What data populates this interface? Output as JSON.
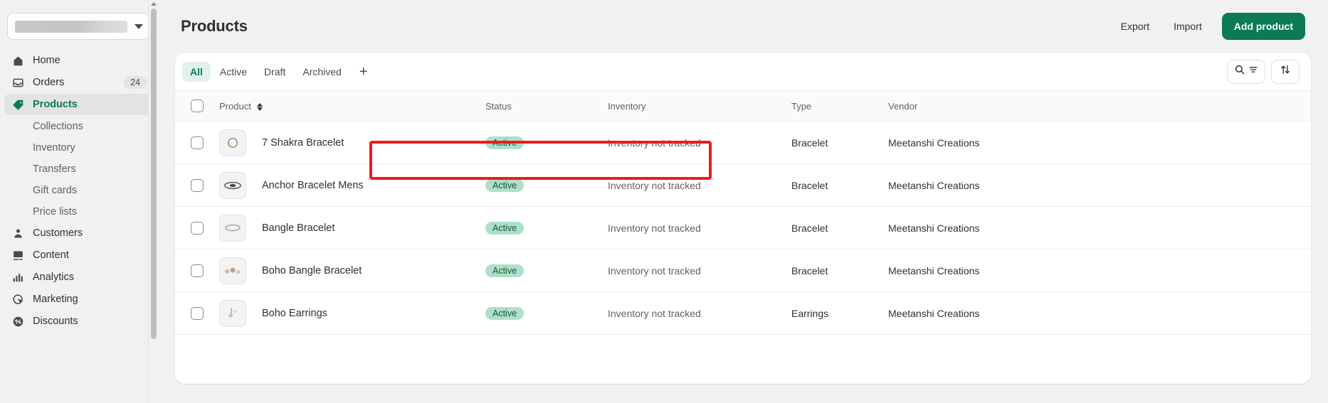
{
  "sidebar": {
    "store_switcher": {
      "name": "store-switcher",
      "value": "",
      "icon": "chevron-down-icon"
    },
    "items": [
      {
        "label": "Home",
        "icon": "home-icon",
        "badge": "",
        "active": false
      },
      {
        "label": "Orders",
        "icon": "orders-icon",
        "badge": "24",
        "active": false
      },
      {
        "label": "Products",
        "icon": "products-tag-icon",
        "badge": "",
        "active": true
      },
      {
        "label": "Customers",
        "icon": "customers-icon",
        "badge": "",
        "active": false
      },
      {
        "label": "Content",
        "icon": "content-image-icon",
        "badge": "",
        "active": false
      },
      {
        "label": "Analytics",
        "icon": "analytics-bars-icon",
        "badge": "",
        "active": false
      },
      {
        "label": "Marketing",
        "icon": "marketing-target-icon",
        "badge": "",
        "active": false
      },
      {
        "label": "Discounts",
        "icon": "discounts-percent-icon",
        "badge": "",
        "active": false
      }
    ],
    "sub_items": [
      {
        "label": "Collections"
      },
      {
        "label": "Inventory"
      },
      {
        "label": "Transfers"
      },
      {
        "label": "Gift cards"
      },
      {
        "label": "Price lists"
      }
    ]
  },
  "header": {
    "title": "Products",
    "export_label": "Export",
    "import_label": "Import",
    "add_product_label": "Add product"
  },
  "tabs": [
    {
      "label": "All",
      "active": true
    },
    {
      "label": "Active",
      "active": false
    },
    {
      "label": "Draft",
      "active": false
    },
    {
      "label": "Archived",
      "active": false
    }
  ],
  "tab_add_label": "+",
  "toolbar": {
    "search_filter_icon": "search-icon",
    "filter_icon": "filter-icon",
    "sort_icon": "sort-arrows-icon"
  },
  "table": {
    "columns": [
      "Product",
      "Status",
      "Inventory",
      "Type",
      "Vendor"
    ],
    "sort_column": "Product",
    "rows": [
      {
        "name": "7 Shakra Bracelet",
        "status": "Active",
        "inventory": "Inventory not tracked",
        "type": "Bracelet",
        "vendor": "Meetanshi Creations",
        "highlighted": true
      },
      {
        "name": "Anchor Bracelet Mens",
        "status": "Active",
        "inventory": "Inventory not tracked",
        "type": "Bracelet",
        "vendor": "Meetanshi Creations",
        "highlighted": false
      },
      {
        "name": "Bangle Bracelet",
        "status": "Active",
        "inventory": "Inventory not tracked",
        "type": "Bracelet",
        "vendor": "Meetanshi Creations",
        "highlighted": false
      },
      {
        "name": "Boho Bangle Bracelet",
        "status": "Active",
        "inventory": "Inventory not tracked",
        "type": "Bracelet",
        "vendor": "Meetanshi Creations",
        "highlighted": false
      },
      {
        "name": "Boho Earrings",
        "status": "Active",
        "inventory": "Inventory not tracked",
        "type": "Earrings",
        "vendor": "Meetanshi Creations",
        "highlighted": false
      }
    ]
  },
  "colors": {
    "brand_green": "#0b7a55",
    "badge_active_bg": "#aee0c8",
    "annotation_red": "#ee1b1b"
  }
}
